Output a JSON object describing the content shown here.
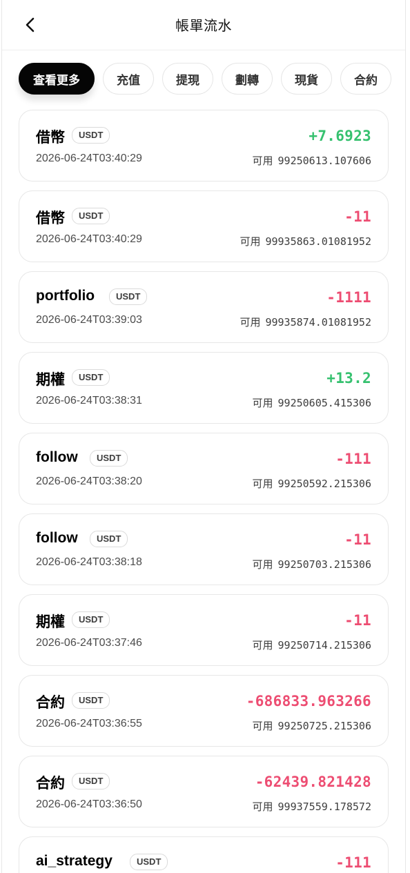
{
  "header": {
    "title": "帳單流水",
    "back_icon": "chevron-left-icon"
  },
  "tabs": [
    {
      "label": "查看更多",
      "active": true
    },
    {
      "label": "充值",
      "active": false
    },
    {
      "label": "提現",
      "active": false
    },
    {
      "label": "劃轉",
      "active": false
    },
    {
      "label": "現貨",
      "active": false
    },
    {
      "label": "合約",
      "active": false
    }
  ],
  "colors": {
    "positive": "#36c16f",
    "negative": "#ed4d72",
    "active_tab_bg": "#050505"
  },
  "transactions": [
    {
      "type": "借幣",
      "currency": "USDT",
      "time": "2026-06-24T03:40:29",
      "amount": "+7.6923",
      "direction": "positive",
      "available_label": "可用",
      "available": "99250613.107606"
    },
    {
      "type": "借幣",
      "currency": "USDT",
      "time": "2026-06-24T03:40:29",
      "amount": "-11",
      "direction": "negative",
      "available_label": "可用",
      "available": "99935863.01081952"
    },
    {
      "type": "portfolio",
      "currency": "USDT",
      "time": "2026-06-24T03:39:03",
      "amount": "-1111",
      "direction": "negative",
      "available_label": "可用",
      "available": "99935874.01081952"
    },
    {
      "type": "期權",
      "currency": "USDT",
      "time": "2026-06-24T03:38:31",
      "amount": "+13.2",
      "direction": "positive",
      "available_label": "可用",
      "available": "99250605.415306"
    },
    {
      "type": "follow",
      "currency": "USDT",
      "time": "2026-06-24T03:38:20",
      "amount": "-111",
      "direction": "negative",
      "available_label": "可用",
      "available": "99250592.215306"
    },
    {
      "type": "follow",
      "currency": "USDT",
      "time": "2026-06-24T03:38:18",
      "amount": "-11",
      "direction": "negative",
      "available_label": "可用",
      "available": "99250703.215306"
    },
    {
      "type": "期權",
      "currency": "USDT",
      "time": "2026-06-24T03:37:46",
      "amount": "-11",
      "direction": "negative",
      "available_label": "可用",
      "available": "99250714.215306"
    },
    {
      "type": "合約",
      "currency": "USDT",
      "time": "2026-06-24T03:36:55",
      "amount": "-686833.963266",
      "direction": "negative",
      "available_label": "可用",
      "available": "99250725.215306"
    },
    {
      "type": "合約",
      "currency": "USDT",
      "time": "2026-06-24T03:36:50",
      "amount": "-62439.821428",
      "direction": "negative",
      "available_label": "可用",
      "available": "99937559.178572"
    },
    {
      "type": "ai_strategy",
      "currency": "USDT",
      "time": "",
      "amount": "-111",
      "direction": "negative",
      "available_label": "",
      "available": ""
    }
  ]
}
